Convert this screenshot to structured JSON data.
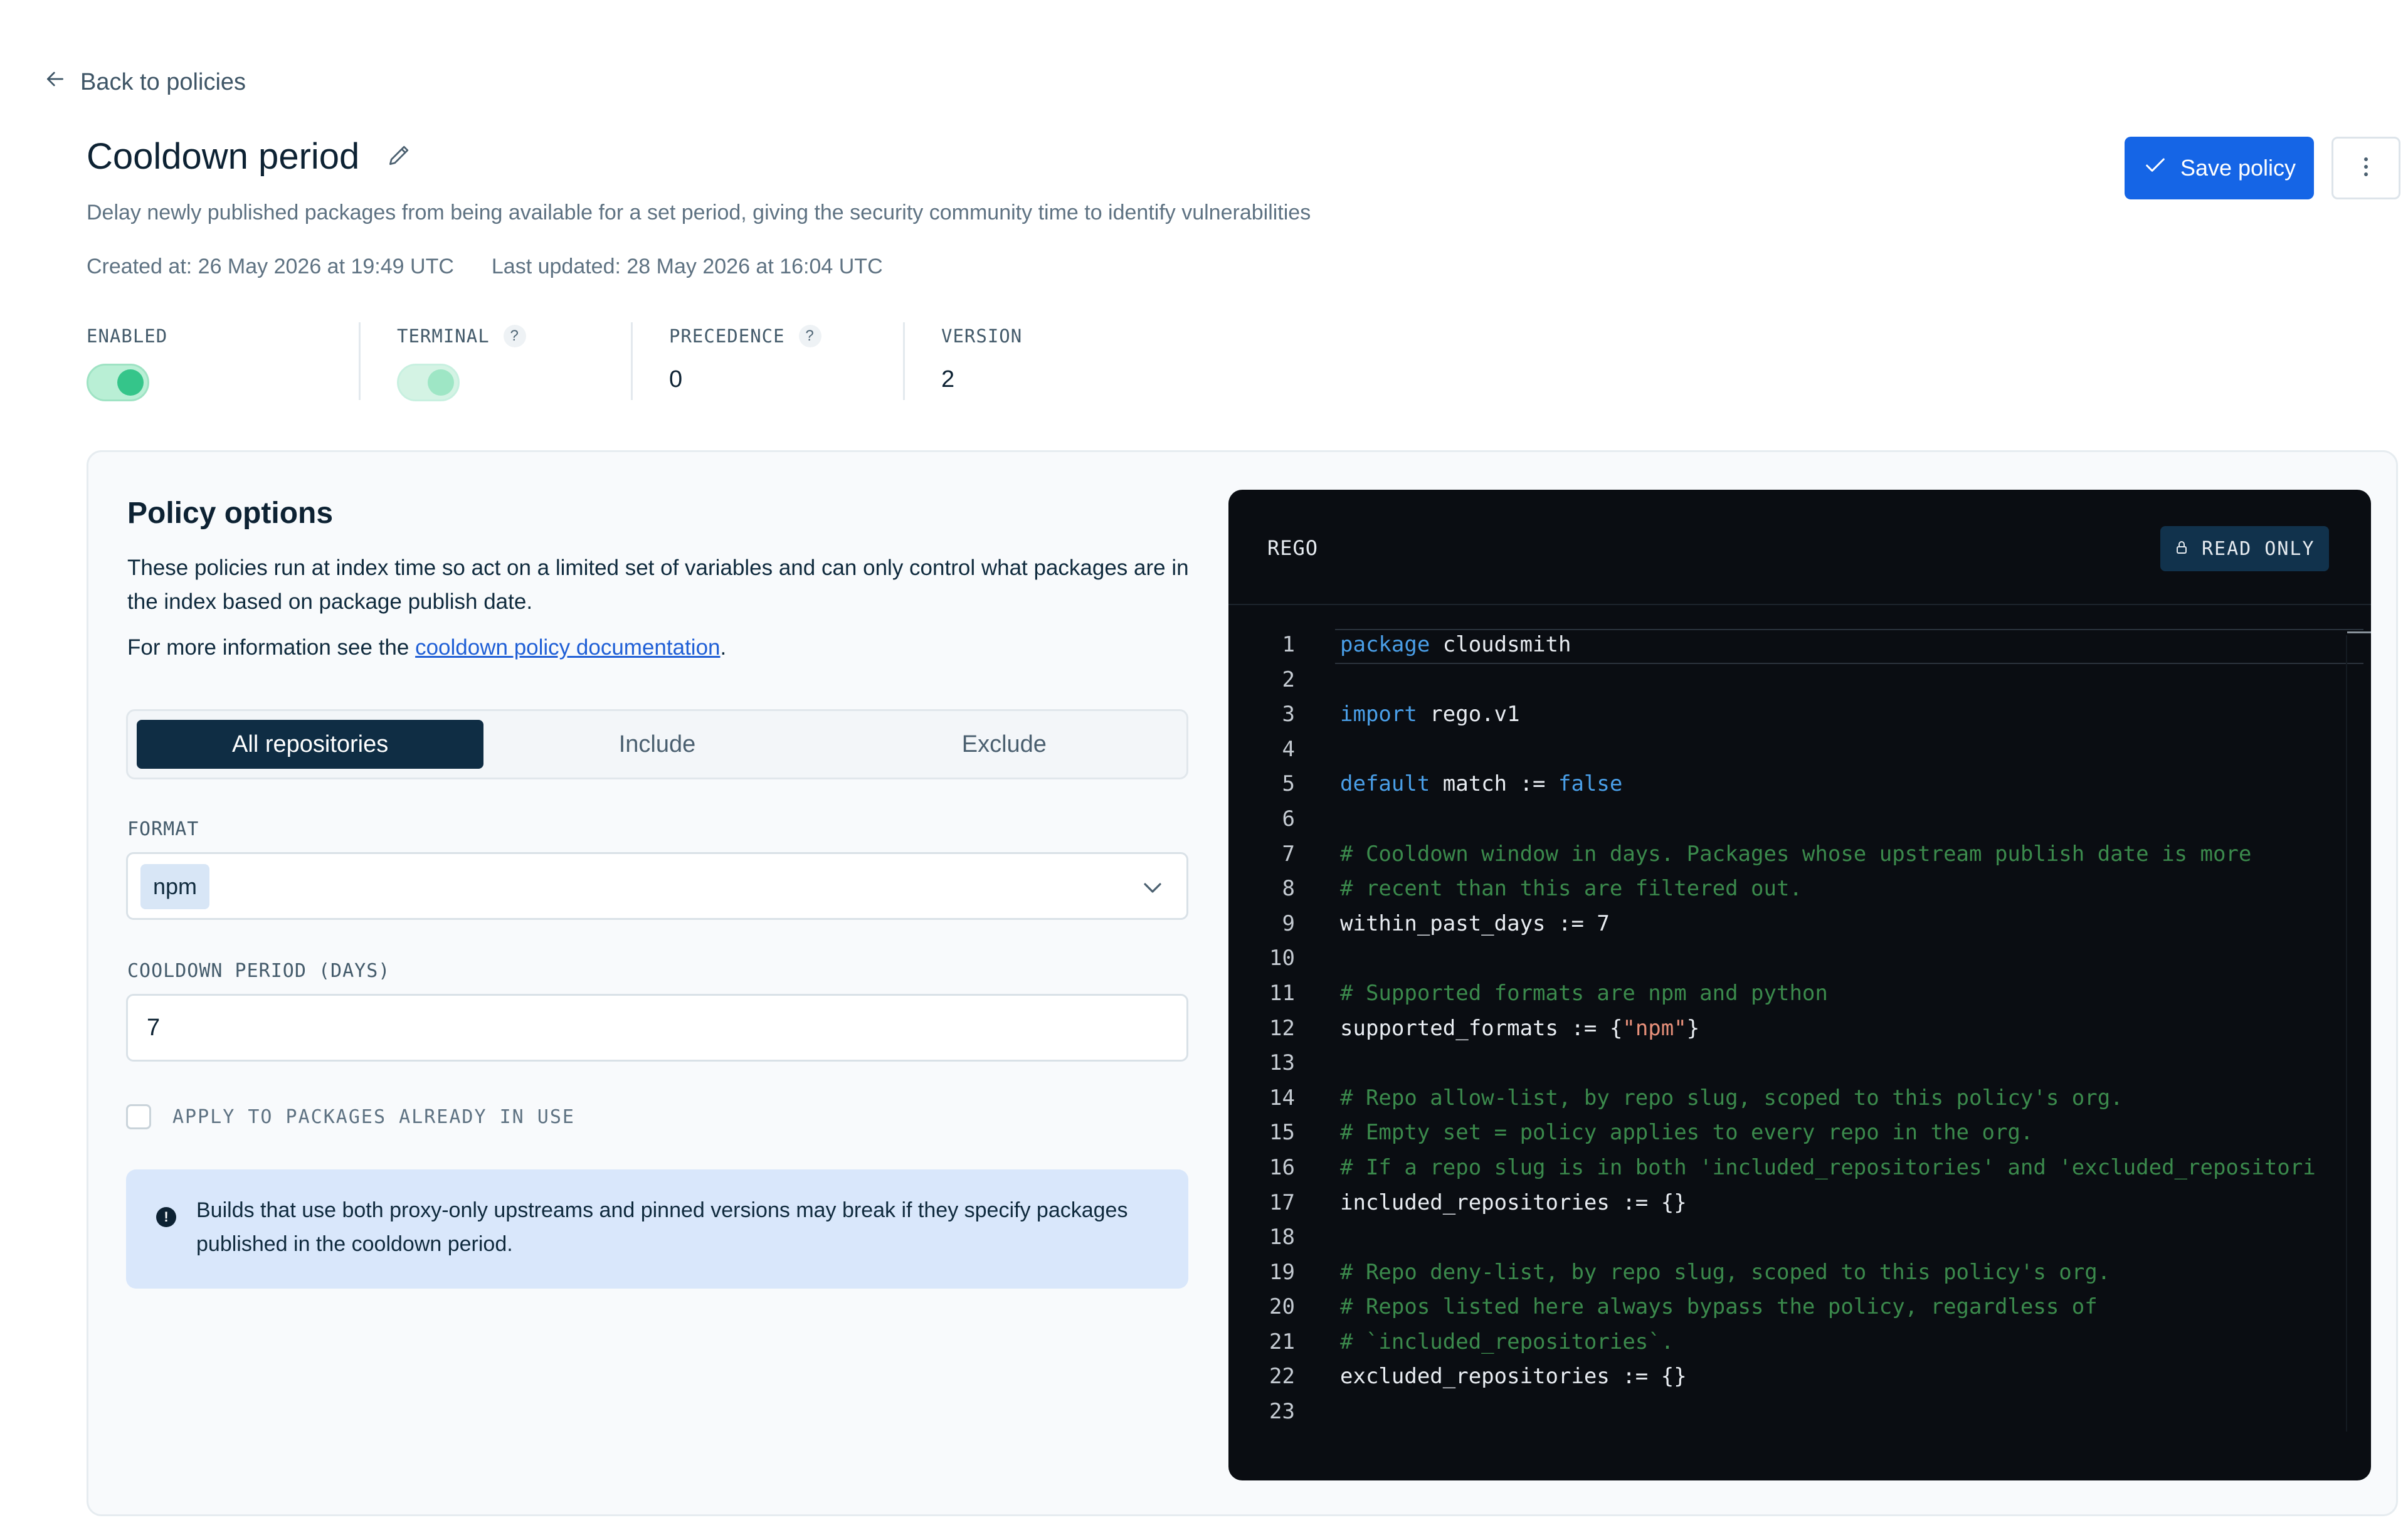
{
  "nav": {
    "back_label": "Back to policies"
  },
  "header": {
    "title": "Cooldown period",
    "subtitle": "Delay newly published packages from being available for a set period, giving the security community time to identify vulnerabilities",
    "created": "Created at: 26 May 2026 at 19:49 UTC",
    "updated": "Last updated: 28 May 2026 at 16:04 UTC",
    "save_label": "Save policy"
  },
  "stats": {
    "enabled": {
      "label": "ENABLED",
      "on": true
    },
    "terminal": {
      "label": "TERMINAL",
      "help": "?",
      "on": true
    },
    "precedence": {
      "label": "PRECEDENCE",
      "help": "?",
      "value": "0"
    },
    "version": {
      "label": "VERSION",
      "value": "2"
    }
  },
  "options": {
    "title": "Policy options",
    "description": "These policies run at index time so act on a limited set of variables and can only control what packages are in the index based on package publish date.",
    "more_prefix": "For more information see the ",
    "more_link": "cooldown policy documentation",
    "more_suffix": ".",
    "tabs": [
      "All repositories",
      "Include",
      "Exclude"
    ],
    "format_label": "FORMAT",
    "format_value": "npm",
    "cooldown_label": "COOLDOWN PERIOD (DAYS)",
    "cooldown_value": "7",
    "apply_label": "APPLY TO PACKAGES ALREADY IN USE",
    "apply_checked": false,
    "notice": "Builds that use both proxy-only upstreams and pinned versions may break if they specify packages published in the cooldown period."
  },
  "code": {
    "language": "REGO",
    "badge": "READ ONLY",
    "lines": [
      [
        [
          "kw",
          "package"
        ],
        [
          "",
          "cloudsmith"
        ]
      ],
      [],
      [
        [
          "kw",
          "import"
        ],
        [
          "",
          "rego.v1"
        ]
      ],
      [],
      [
        [
          "kw",
          "default"
        ],
        [
          "",
          "match := "
        ],
        [
          "kw",
          "false"
        ]
      ],
      [],
      [
        [
          "cm",
          "# Cooldown window in days. Packages whose upstream publish date is more"
        ]
      ],
      [
        [
          "cm",
          "# recent than this are filtered out."
        ]
      ],
      [
        [
          "",
          "within_past_days := 7"
        ]
      ],
      [],
      [
        [
          "cm",
          "# Supported formats are npm and python"
        ]
      ],
      [
        [
          "",
          "supported_formats := {"
        ],
        [
          "st",
          "\"npm\""
        ],
        [
          "",
          "}"
        ]
      ],
      [],
      [
        [
          "cm",
          "# Repo allow-list, by repo slug, scoped to this policy's org."
        ]
      ],
      [
        [
          "cm",
          "# Empty set = policy applies to every repo in the org."
        ]
      ],
      [
        [
          "cm",
          "# If a repo slug is in both 'included_repositories' and 'excluded_repositori"
        ]
      ],
      [
        [
          "",
          "included_repositories := {}"
        ]
      ],
      [],
      [
        [
          "cm",
          "# Repo deny-list, by repo slug, scoped to this policy's org."
        ]
      ],
      [
        [
          "cm",
          "# Repos listed here always bypass the policy, regardless of"
        ]
      ],
      [
        [
          "cm",
          "# `included_repositories`."
        ]
      ],
      [
        [
          "",
          "excluded_repositories := {}"
        ]
      ],
      []
    ]
  },
  "colors": {
    "primary": "#1565e6",
    "toggle_on": "#35c58a",
    "tab_active": "#0f2d44",
    "code_bg": "#0a0d12"
  }
}
